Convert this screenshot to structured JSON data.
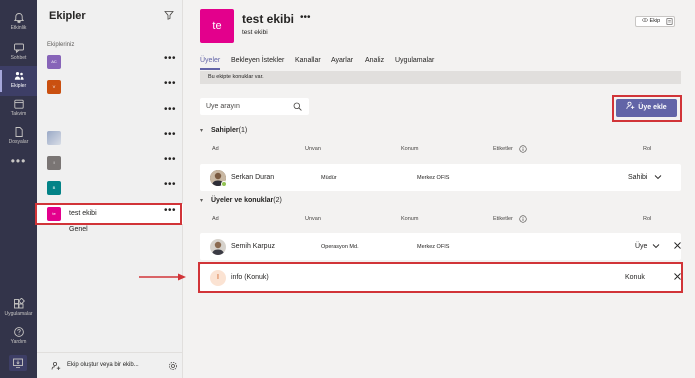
{
  "rail": {
    "items": [
      {
        "label": "Etkinlik",
        "icon": "bell-icon"
      },
      {
        "label": "Sohbet",
        "icon": "chat-icon"
      },
      {
        "label": "Ekipler",
        "icon": "teams-icon"
      },
      {
        "label": "Takvim",
        "icon": "calendar-icon"
      },
      {
        "label": "Dosyalar",
        "icon": "files-icon"
      }
    ],
    "more": "•••",
    "bottom_items": [
      {
        "label": "Uygulamalar",
        "icon": "apps-icon"
      },
      {
        "label": "Yardım",
        "icon": "help-icon"
      }
    ]
  },
  "panel": {
    "title": "Ekipler",
    "section_label": "Ekipleriniz",
    "teams": [
      {
        "initials": "AC",
        "color": "#8764b8",
        "name": ""
      },
      {
        "initials": "V",
        "color": "#ca5010",
        "name": ""
      },
      {
        "initials": "",
        "color": "#f0f0f0",
        "name": ""
      },
      {
        "initials": "",
        "color": "#9aa9c6",
        "name": ""
      },
      {
        "initials": "I",
        "color": "#7a7574",
        "name": ""
      },
      {
        "initials": "B",
        "color": "#038387",
        "name": ""
      },
      {
        "initials": "te",
        "color": "#e3008c",
        "name": "test ekibi"
      }
    ],
    "more": "•••",
    "channel": "Genel",
    "join_text": "Ekip oluştur veya bir ekib..."
  },
  "main": {
    "avatar_text": "te",
    "avatar_color": "#e3008c",
    "title": "test ekibi",
    "title_more": "•••",
    "subtitle": "test ekibi",
    "badge": "Ekip",
    "tabs": [
      "Üyeler",
      "Bekleyen İstekler",
      "Kanallar",
      "Ayarlar",
      "Analiz",
      "Uygulamalar"
    ],
    "notice": "Bu ekipte konuklar var.",
    "search_placeholder": "Üye arayın",
    "add_button": "Üye ekle",
    "columns": {
      "name": "Ad",
      "title": "Unvan",
      "location": "Konum",
      "tags": "Etiketler",
      "role": "Rol"
    },
    "owners": {
      "title": "Sahipler",
      "count": "(1)",
      "members": [
        {
          "name": "Serkan Duran",
          "title": "Müdür",
          "location": "Merkez OFIS",
          "role": "Sahibi"
        }
      ]
    },
    "guests": {
      "title": "Üyeler ve konuklar",
      "count": "(2)",
      "members": [
        {
          "name": "Semih Karpuz",
          "title": "Operasyon Md.",
          "location": "Merkez OFIS",
          "role": "Üye"
        },
        {
          "name": "info (Konuk)",
          "initial": "I",
          "title": "",
          "location": "",
          "role": "Konuk"
        }
      ]
    }
  },
  "colors": {
    "accent": "#6264a7",
    "rail": "#33344a",
    "highlight": "#d13438"
  }
}
